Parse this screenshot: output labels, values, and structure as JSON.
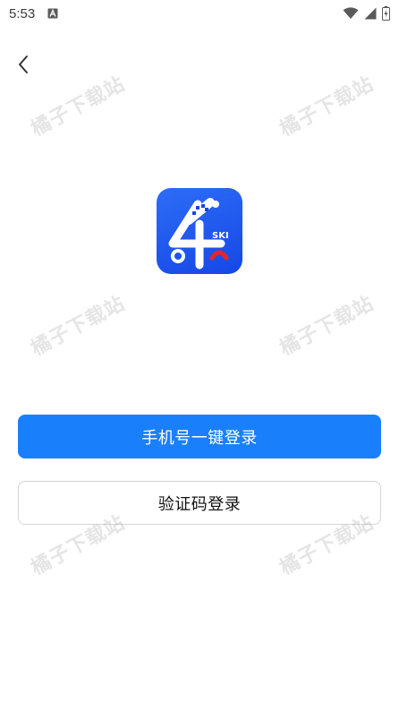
{
  "status_bar": {
    "time": "5:53",
    "icons": [
      "notification-a-icon",
      "wifi-icon",
      "signal-icon",
      "battery-charging-icon"
    ]
  },
  "nav": {
    "back_icon": "chevron-left-icon"
  },
  "logo": {
    "text": "SKI",
    "brand_blue": "#1a56f0",
    "accent_red": "#e8232a"
  },
  "actions": {
    "primary_label": "手机号一键登录",
    "secondary_label": "验证码登录",
    "primary_color": "#1a7ffb"
  },
  "watermark": {
    "text": "橘子下载站"
  }
}
